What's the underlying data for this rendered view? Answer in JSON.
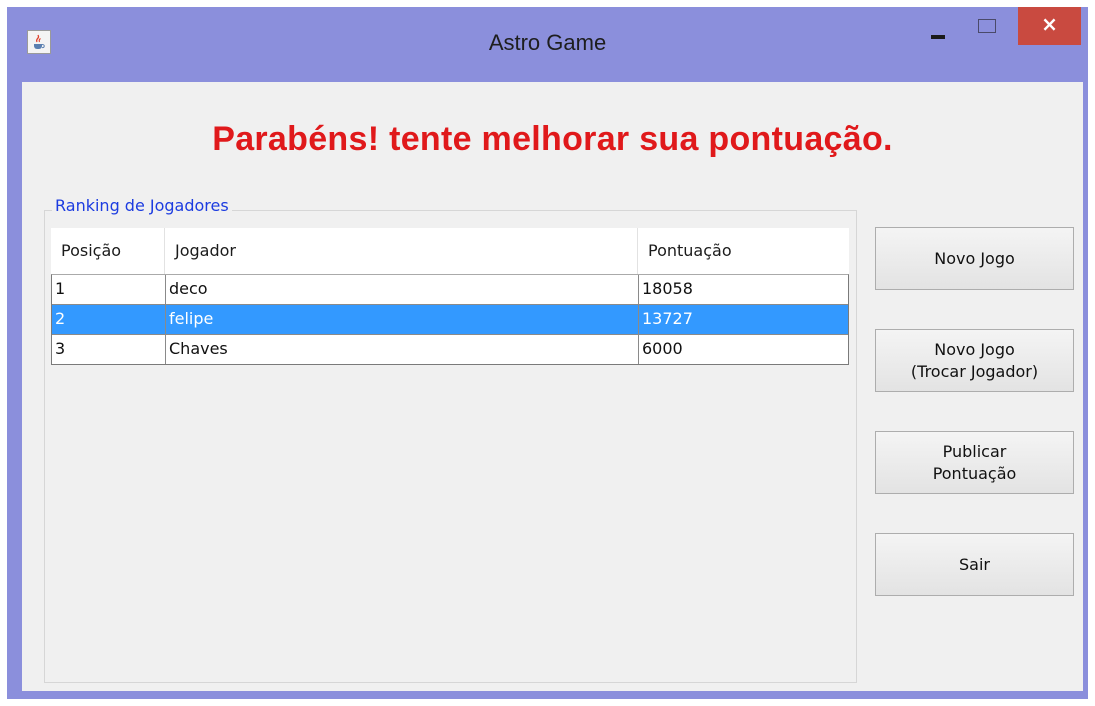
{
  "window": {
    "title": "Astro Game",
    "icon": "java-cup-icon",
    "controls": {
      "minimize": "minimize-icon",
      "maximize": "maximize-icon",
      "close": "×"
    }
  },
  "headline": "Parabéns! tente melhorar sua pontuação.",
  "ranking": {
    "group_label": "Ranking de Jogadores",
    "columns": [
      "Posição",
      "Jogador",
      "Pontuação"
    ],
    "rows": [
      {
        "pos": "1",
        "player": "deco",
        "score": "18058",
        "selected": false
      },
      {
        "pos": "2",
        "player": "felipe",
        "score": "13727",
        "selected": true
      },
      {
        "pos": "3",
        "player": "Chaves",
        "score": "6000",
        "selected": false
      }
    ]
  },
  "buttons": {
    "novo_jogo": [
      "Novo Jogo"
    ],
    "trocar": [
      "Novo Jogo",
      "(Trocar Jogador)"
    ],
    "publicar": [
      "Publicar",
      "Pontuação"
    ],
    "sair": [
      "Sair"
    ]
  },
  "colors": {
    "titlebar": "#8b8fdc",
    "headline": "#e0191b",
    "group_label": "#1c3ce0",
    "selection": "#3399ff",
    "close_button": "#c94a40"
  }
}
